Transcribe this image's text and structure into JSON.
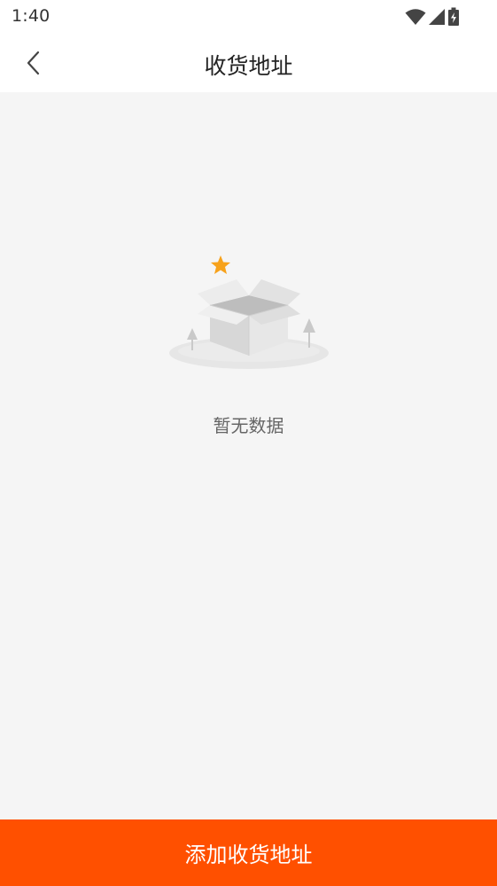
{
  "status_bar": {
    "time": "1:40",
    "icons": [
      "wifi-icon",
      "cellular-signal-icon",
      "battery-charging-icon"
    ]
  },
  "nav": {
    "back_icon": "chevron-left-icon",
    "title": "收货地址"
  },
  "empty_state": {
    "illustration": "open-box-icon",
    "text": "暂无数据"
  },
  "footer": {
    "add_button_label": "添加收货地址"
  },
  "colors": {
    "accent": "#ff5000",
    "background": "#f5f5f5",
    "star": "#f7a21b"
  }
}
